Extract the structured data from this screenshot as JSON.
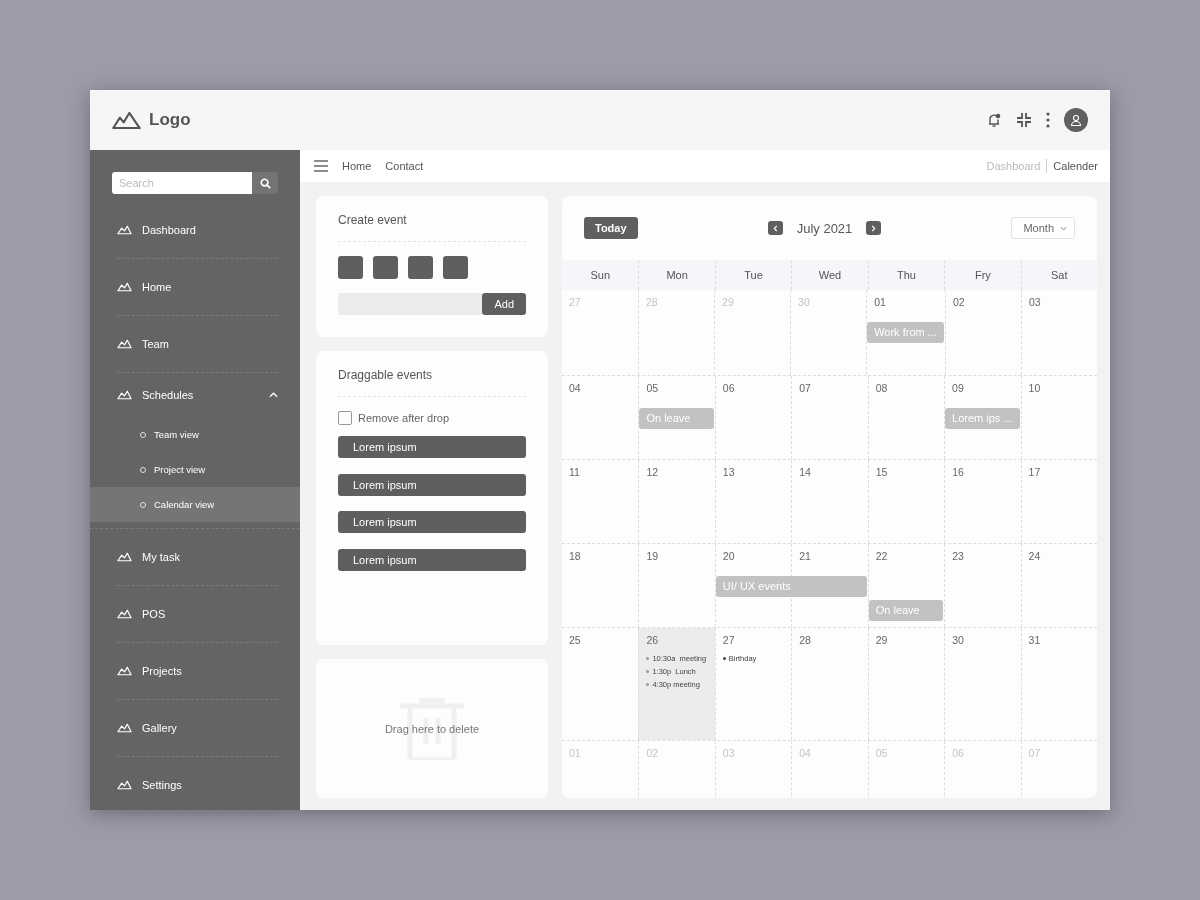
{
  "header": {
    "logo": "Logo"
  },
  "sidebar": {
    "search": {
      "placeholder": "Search"
    },
    "items": [
      {
        "label": "Dashboard"
      },
      {
        "label": "Home"
      },
      {
        "label": "Team"
      },
      {
        "label": "Schedules",
        "expanded": true,
        "children": [
          {
            "label": "Team view",
            "selected": false
          },
          {
            "label": "Project view",
            "selected": false
          },
          {
            "label": "Calendar view",
            "selected": true
          }
        ]
      },
      {
        "label": "My task"
      },
      {
        "label": "POS"
      },
      {
        "label": "Projects"
      },
      {
        "label": "Gallery"
      },
      {
        "label": "Settings"
      }
    ]
  },
  "topbar": {
    "links": [
      "Home",
      "Contact"
    ],
    "breadcrumb": [
      {
        "label": "Dashboard",
        "current": false
      },
      {
        "label": "Calender",
        "current": true
      }
    ]
  },
  "create_event": {
    "title": "Create event",
    "add_button": "Add"
  },
  "draggable_events": {
    "title": "Draggable events",
    "remove_after_drop": {
      "label": "Remove after drop",
      "checked": false
    },
    "events": [
      "Lorem ipsum",
      "Lorem ipsum",
      "Lorem ipsum",
      "Lorem ipsum"
    ]
  },
  "delete_zone": {
    "label": "Drag here to delete"
  },
  "calendar": {
    "today_button": "Today",
    "month": "July 2021",
    "view": "Month",
    "weekdays": [
      "Sun",
      "Mon",
      "Tue",
      "Wed",
      "Thu",
      "Fry",
      "Sat"
    ],
    "weeks": [
      {
        "days": [
          {
            "date": "27",
            "outside": true,
            "today": false
          },
          {
            "date": "28",
            "outside": true,
            "today": false
          },
          {
            "date": "29",
            "outside": true,
            "today": false
          },
          {
            "date": "30",
            "outside": true,
            "today": false
          },
          {
            "date": "01",
            "outside": false,
            "today": false,
            "events": [
              {
                "kind": "bar",
                "label": "Work from ...",
                "continues": false
              }
            ]
          },
          {
            "date": "02",
            "outside": false,
            "today": false
          },
          {
            "date": "03",
            "outside": false,
            "today": false
          }
        ]
      },
      {
        "days": [
          {
            "date": "04",
            "outside": false,
            "today": false
          },
          {
            "date": "05",
            "outside": false,
            "today": false,
            "events": [
              {
                "kind": "bar",
                "label": "On leave",
                "continues": false
              }
            ]
          },
          {
            "date": "06",
            "outside": false,
            "today": false
          },
          {
            "date": "07",
            "outside": false,
            "today": false
          },
          {
            "date": "08",
            "outside": false,
            "today": false
          },
          {
            "date": "09",
            "outside": false,
            "today": false,
            "events": [
              {
                "kind": "bar",
                "label": "Lorem ips ...",
                "continues": false
              }
            ]
          },
          {
            "date": "10",
            "outside": false,
            "today": false
          }
        ]
      },
      {
        "days": [
          {
            "date": "11",
            "outside": false,
            "today": false
          },
          {
            "date": "12",
            "outside": false,
            "today": false
          },
          {
            "date": "13",
            "outside": false,
            "today": false
          },
          {
            "date": "14",
            "outside": false,
            "today": false
          },
          {
            "date": "15",
            "outside": false,
            "today": false
          },
          {
            "date": "16",
            "outside": false,
            "today": false
          },
          {
            "date": "17",
            "outside": false,
            "today": false
          }
        ]
      },
      {
        "days": [
          {
            "date": "18",
            "outside": false,
            "today": false
          },
          {
            "date": "19",
            "outside": false,
            "today": false
          },
          {
            "date": "20",
            "outside": false,
            "today": false,
            "events": [
              {
                "kind": "bar",
                "label": "UI/ UX events",
                "continues": true
              }
            ]
          },
          {
            "date": "21",
            "outside": false,
            "today": false
          },
          {
            "date": "22",
            "outside": false,
            "today": false,
            "events": [
              {
                "kind": "bar",
                "label": "On leave",
                "continues": false
              }
            ]
          },
          {
            "date": "23",
            "outside": false,
            "today": false
          },
          {
            "date": "24",
            "outside": false,
            "today": false
          }
        ]
      },
      {
        "days": [
          {
            "date": "25",
            "outside": false,
            "today": false
          },
          {
            "date": "26",
            "outside": false,
            "today": true,
            "events": [
              {
                "kind": "dot",
                "label": "10:30a  meeting"
              },
              {
                "kind": "dot",
                "label": "1:30p  Lunch"
              },
              {
                "kind": "dot",
                "label": "4:30p meeting"
              }
            ]
          },
          {
            "date": "27",
            "outside": false,
            "today": false,
            "events": [
              {
                "kind": "dot",
                "label": "Birthday"
              }
            ]
          },
          {
            "date": "28",
            "outside": false,
            "today": false
          },
          {
            "date": "29",
            "outside": false,
            "today": false
          },
          {
            "date": "30",
            "outside": false,
            "today": false
          },
          {
            "date": "31",
            "outside": false,
            "today": false
          }
        ]
      },
      {
        "days": [
          {
            "date": "01",
            "outside": true,
            "today": false
          },
          {
            "date": "02",
            "outside": true,
            "today": false
          },
          {
            "date": "03",
            "outside": true,
            "today": false
          },
          {
            "date": "04",
            "outside": true,
            "today": false
          },
          {
            "date": "05",
            "outside": true,
            "today": false
          },
          {
            "date": "06",
            "outside": true,
            "today": false
          },
          {
            "date": "07",
            "outside": true,
            "today": false
          }
        ]
      }
    ]
  }
}
